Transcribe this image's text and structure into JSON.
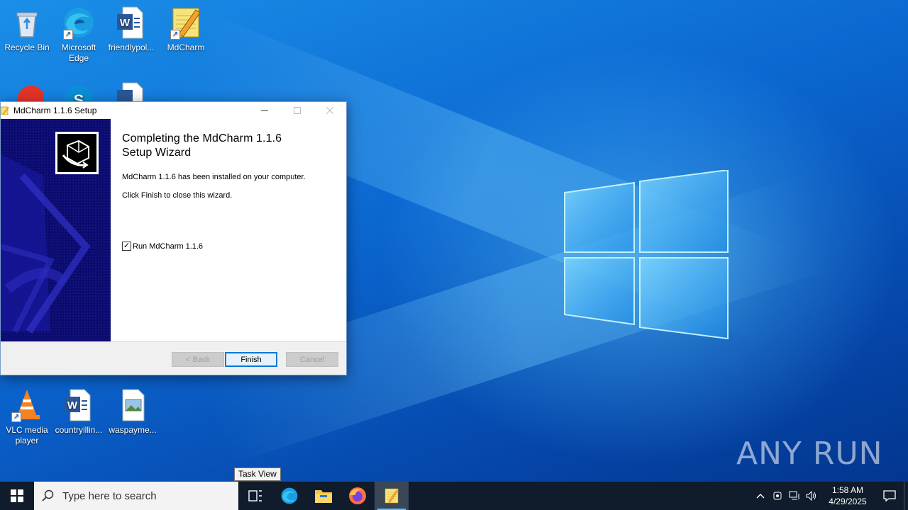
{
  "desktop": {
    "icons": [
      {
        "label": "Recycle Bin"
      },
      {
        "label": "Microsoft Edge"
      },
      {
        "label": "friendlypol..."
      },
      {
        "label": "MdCharm"
      },
      {
        "label": "VLC media player"
      },
      {
        "label": "countryillin..."
      },
      {
        "label": "waspayme..."
      }
    ]
  },
  "dialog": {
    "title": "MdCharm 1.1.6 Setup",
    "heading_line1": "Completing the MdCharm 1.1.6",
    "heading_line2": "Setup Wizard",
    "installed_text": "MdCharm 1.1.6 has been installed on your computer.",
    "close_text": "Click Finish to close this wizard.",
    "run_checkbox_label": "Run MdCharm 1.1.6",
    "run_checked": true,
    "back_label": "< Back",
    "finish_label": "Finish",
    "cancel_label": "Cancel"
  },
  "tooltip": {
    "text": "Task View"
  },
  "taskbar": {
    "search_placeholder": "Type here to search",
    "apps": [
      "task-view",
      "edge",
      "file-explorer",
      "firefox",
      "mdcharm"
    ],
    "time": "1:58 AM",
    "date": "4/29/2025"
  },
  "watermark": {
    "text": "ANY RUN"
  },
  "colors": {
    "accent": "#0078d7",
    "taskbar": "#101c2b",
    "banner": "#0b0b6e"
  }
}
